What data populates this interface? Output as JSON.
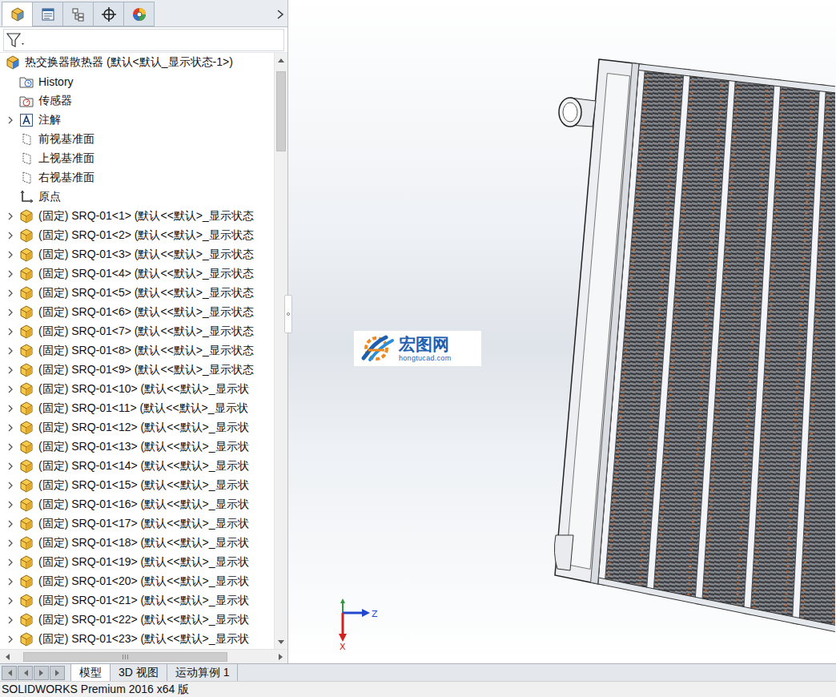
{
  "window": {
    "title": "SOLIDWORKS Premium 2016 x64 版"
  },
  "panel_tabs": [
    {
      "selected": true
    },
    {
      "selected": false
    },
    {
      "selected": false
    },
    {
      "selected": false
    },
    {
      "selected": false
    }
  ],
  "tree": {
    "root": "热交换器散热器 (默认<默认_显示状态-1>)",
    "items": [
      {
        "label": "History",
        "kind": "history",
        "expandable": false
      },
      {
        "label": "传感器",
        "kind": "sensor",
        "expandable": false
      },
      {
        "label": "注解",
        "kind": "annotation",
        "expandable": true
      },
      {
        "label": "前视基准面",
        "kind": "plane",
        "expandable": false
      },
      {
        "label": "上视基准面",
        "kind": "plane",
        "expandable": false
      },
      {
        "label": "右视基准面",
        "kind": "plane",
        "expandable": false
      },
      {
        "label": "原点",
        "kind": "origin",
        "expandable": false
      },
      {
        "label": "(固定) SRQ-01<1> (默认<<默认>_显示状态",
        "kind": "part",
        "expandable": true
      },
      {
        "label": "(固定) SRQ-01<2> (默认<<默认>_显示状态",
        "kind": "part",
        "expandable": true
      },
      {
        "label": "(固定) SRQ-01<3> (默认<<默认>_显示状态",
        "kind": "part",
        "expandable": true
      },
      {
        "label": "(固定) SRQ-01<4> (默认<<默认>_显示状态",
        "kind": "part",
        "expandable": true
      },
      {
        "label": "(固定) SRQ-01<5> (默认<<默认>_显示状态",
        "kind": "part",
        "expandable": true
      },
      {
        "label": "(固定) SRQ-01<6> (默认<<默认>_显示状态",
        "kind": "part",
        "expandable": true
      },
      {
        "label": "(固定) SRQ-01<7> (默认<<默认>_显示状态",
        "kind": "part",
        "expandable": true
      },
      {
        "label": "(固定) SRQ-01<8> (默认<<默认>_显示状态",
        "kind": "part",
        "expandable": true
      },
      {
        "label": "(固定) SRQ-01<9> (默认<<默认>_显示状态",
        "kind": "part",
        "expandable": true
      },
      {
        "label": "(固定) SRQ-01<10> (默认<<默认>_显示状",
        "kind": "part",
        "expandable": true
      },
      {
        "label": "(固定) SRQ-01<11> (默认<<默认>_显示状",
        "kind": "part",
        "expandable": true
      },
      {
        "label": "(固定) SRQ-01<12> (默认<<默认>_显示状",
        "kind": "part",
        "expandable": true
      },
      {
        "label": "(固定) SRQ-01<13> (默认<<默认>_显示状",
        "kind": "part",
        "expandable": true
      },
      {
        "label": "(固定) SRQ-01<14> (默认<<默认>_显示状",
        "kind": "part",
        "expandable": true
      },
      {
        "label": "(固定) SRQ-01<15> (默认<<默认>_显示状",
        "kind": "part",
        "expandable": true
      },
      {
        "label": "(固定) SRQ-01<16> (默认<<默认>_显示状",
        "kind": "part",
        "expandable": true
      },
      {
        "label": "(固定) SRQ-01<17> (默认<<默认>_显示状",
        "kind": "part",
        "expandable": true
      },
      {
        "label": "(固定) SRQ-01<18> (默认<<默认>_显示状",
        "kind": "part",
        "expandable": true
      },
      {
        "label": "(固定) SRQ-01<19> (默认<<默认>_显示状",
        "kind": "part",
        "expandable": true
      },
      {
        "label": "(固定) SRQ-01<20> (默认<<默认>_显示状",
        "kind": "part",
        "expandable": true
      },
      {
        "label": "(固定) SRQ-01<21> (默认<<默认>_显示状",
        "kind": "part",
        "expandable": true
      },
      {
        "label": "(固定) SRQ-01<22> (默认<<默认>_显示状",
        "kind": "part",
        "expandable": true
      },
      {
        "label": "(固定) SRQ-01<23> (默认<<默认>_显示状",
        "kind": "part",
        "expandable": true
      }
    ]
  },
  "watermark": {
    "name": "宏图网",
    "url": "hongtucad.com"
  },
  "triad": {
    "x": "X",
    "z": "Z"
  },
  "bottom_tabs": [
    {
      "label": "模型",
      "selected": true
    },
    {
      "label": "3D 视图",
      "selected": false
    },
    {
      "label": "运动算例 1",
      "selected": false
    }
  ],
  "status_bar": "SOLIDWORKS Premium 2016 x64 版"
}
